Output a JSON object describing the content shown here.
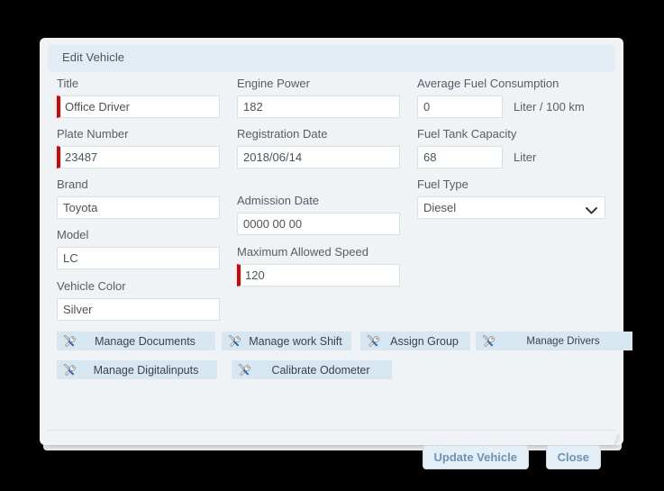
{
  "dialog": {
    "title": "Edit Vehicle",
    "colors": {
      "titlebar_bg": "#e2ecf5",
      "body_bg": "#eff3f6",
      "required_marker": "#dd0000",
      "tool_button_bg": "#d7e7f2",
      "footer_button_bg": "#e3eef7",
      "footer_button_text": "#6e93b3"
    }
  },
  "form": {
    "column_1": [
      {
        "label": "Title",
        "value": "Office Driver",
        "required": true,
        "placeholder": ""
      },
      {
        "label": "Plate Number",
        "value": "23487",
        "required": true,
        "placeholder": ""
      },
      {
        "label": "Brand",
        "value": "Toyota",
        "required": false,
        "placeholder": ""
      },
      {
        "label": "Model",
        "value": "LC",
        "required": false,
        "placeholder": ""
      },
      {
        "label": "Vehicle Color",
        "value": "Silver",
        "required": false,
        "placeholder": ""
      }
    ],
    "column_2": [
      {
        "label": "Engine Power",
        "value": "182",
        "required": false,
        "placeholder": ""
      },
      {
        "label": "Registration Date",
        "value": "2018/06/14",
        "required": false,
        "placeholder": ""
      },
      {
        "label": "Admission Date",
        "value": "0000 00 00",
        "required": false,
        "placeholder": ""
      },
      {
        "label": "Maximum Allowed Speed",
        "value": "120",
        "required": true,
        "placeholder": ""
      }
    ],
    "column_3": [
      {
        "label": "Average Fuel Consumption",
        "value": "0",
        "unit": "Liter / 100 km",
        "required": false,
        "placeholder": ""
      },
      {
        "label": "Fuel Tank Capacity",
        "value": "68",
        "unit": "Liter",
        "required": false,
        "placeholder": ""
      }
    ],
    "fuel_type": {
      "label": "Fuel Type",
      "selected": "Diesel",
      "options": [
        "Diesel"
      ]
    }
  },
  "tool_buttons": {
    "icon": "wrench-screwdriver-icon",
    "row_1": [
      {
        "label": "Manage Documents"
      },
      {
        "label": "Manage work Shift"
      },
      {
        "label": "Assign Group"
      },
      {
        "label": "Manage Drivers"
      }
    ],
    "row_2": [
      {
        "label": "Manage Digitalinputs"
      },
      {
        "label": "Calibrate Odometer"
      }
    ]
  },
  "footer": {
    "update_label": "Update Vehicle",
    "close_label": "Close"
  }
}
